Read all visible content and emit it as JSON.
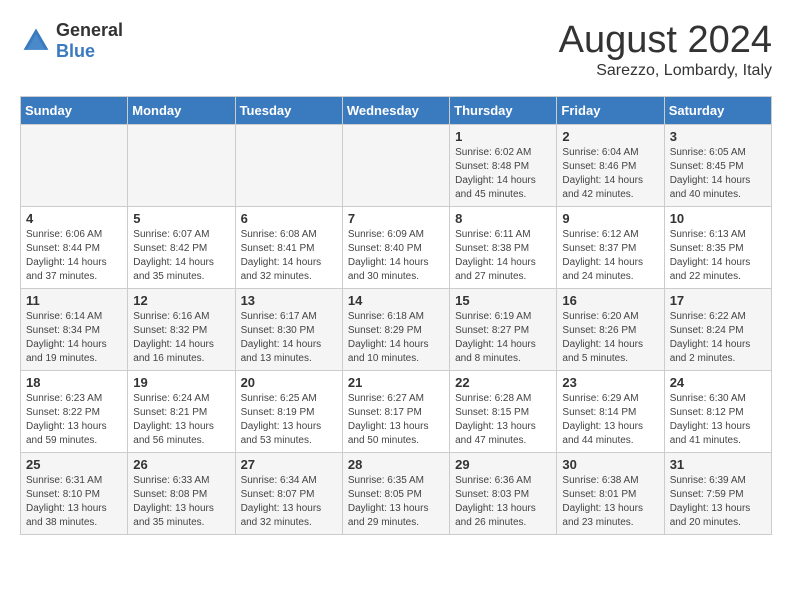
{
  "logo": {
    "general": "General",
    "blue": "Blue"
  },
  "calendar": {
    "title": "August 2024",
    "subtitle": "Sarezzo, Lombardy, Italy"
  },
  "headers": [
    "Sunday",
    "Monday",
    "Tuesday",
    "Wednesday",
    "Thursday",
    "Friday",
    "Saturday"
  ],
  "weeks": [
    [
      {
        "day": "",
        "info": ""
      },
      {
        "day": "",
        "info": ""
      },
      {
        "day": "",
        "info": ""
      },
      {
        "day": "",
        "info": ""
      },
      {
        "day": "1",
        "info": "Sunrise: 6:02 AM\nSunset: 8:48 PM\nDaylight: 14 hours\nand 45 minutes."
      },
      {
        "day": "2",
        "info": "Sunrise: 6:04 AM\nSunset: 8:46 PM\nDaylight: 14 hours\nand 42 minutes."
      },
      {
        "day": "3",
        "info": "Sunrise: 6:05 AM\nSunset: 8:45 PM\nDaylight: 14 hours\nand 40 minutes."
      }
    ],
    [
      {
        "day": "4",
        "info": "Sunrise: 6:06 AM\nSunset: 8:44 PM\nDaylight: 14 hours\nand 37 minutes."
      },
      {
        "day": "5",
        "info": "Sunrise: 6:07 AM\nSunset: 8:42 PM\nDaylight: 14 hours\nand 35 minutes."
      },
      {
        "day": "6",
        "info": "Sunrise: 6:08 AM\nSunset: 8:41 PM\nDaylight: 14 hours\nand 32 minutes."
      },
      {
        "day": "7",
        "info": "Sunrise: 6:09 AM\nSunset: 8:40 PM\nDaylight: 14 hours\nand 30 minutes."
      },
      {
        "day": "8",
        "info": "Sunrise: 6:11 AM\nSunset: 8:38 PM\nDaylight: 14 hours\nand 27 minutes."
      },
      {
        "day": "9",
        "info": "Sunrise: 6:12 AM\nSunset: 8:37 PM\nDaylight: 14 hours\nand 24 minutes."
      },
      {
        "day": "10",
        "info": "Sunrise: 6:13 AM\nSunset: 8:35 PM\nDaylight: 14 hours\nand 22 minutes."
      }
    ],
    [
      {
        "day": "11",
        "info": "Sunrise: 6:14 AM\nSunset: 8:34 PM\nDaylight: 14 hours\nand 19 minutes."
      },
      {
        "day": "12",
        "info": "Sunrise: 6:16 AM\nSunset: 8:32 PM\nDaylight: 14 hours\nand 16 minutes."
      },
      {
        "day": "13",
        "info": "Sunrise: 6:17 AM\nSunset: 8:30 PM\nDaylight: 14 hours\nand 13 minutes."
      },
      {
        "day": "14",
        "info": "Sunrise: 6:18 AM\nSunset: 8:29 PM\nDaylight: 14 hours\nand 10 minutes."
      },
      {
        "day": "15",
        "info": "Sunrise: 6:19 AM\nSunset: 8:27 PM\nDaylight: 14 hours\nand 8 minutes."
      },
      {
        "day": "16",
        "info": "Sunrise: 6:20 AM\nSunset: 8:26 PM\nDaylight: 14 hours\nand 5 minutes."
      },
      {
        "day": "17",
        "info": "Sunrise: 6:22 AM\nSunset: 8:24 PM\nDaylight: 14 hours\nand 2 minutes."
      }
    ],
    [
      {
        "day": "18",
        "info": "Sunrise: 6:23 AM\nSunset: 8:22 PM\nDaylight: 13 hours\nand 59 minutes."
      },
      {
        "day": "19",
        "info": "Sunrise: 6:24 AM\nSunset: 8:21 PM\nDaylight: 13 hours\nand 56 minutes."
      },
      {
        "day": "20",
        "info": "Sunrise: 6:25 AM\nSunset: 8:19 PM\nDaylight: 13 hours\nand 53 minutes."
      },
      {
        "day": "21",
        "info": "Sunrise: 6:27 AM\nSunset: 8:17 PM\nDaylight: 13 hours\nand 50 minutes."
      },
      {
        "day": "22",
        "info": "Sunrise: 6:28 AM\nSunset: 8:15 PM\nDaylight: 13 hours\nand 47 minutes."
      },
      {
        "day": "23",
        "info": "Sunrise: 6:29 AM\nSunset: 8:14 PM\nDaylight: 13 hours\nand 44 minutes."
      },
      {
        "day": "24",
        "info": "Sunrise: 6:30 AM\nSunset: 8:12 PM\nDaylight: 13 hours\nand 41 minutes."
      }
    ],
    [
      {
        "day": "25",
        "info": "Sunrise: 6:31 AM\nSunset: 8:10 PM\nDaylight: 13 hours\nand 38 minutes."
      },
      {
        "day": "26",
        "info": "Sunrise: 6:33 AM\nSunset: 8:08 PM\nDaylight: 13 hours\nand 35 minutes."
      },
      {
        "day": "27",
        "info": "Sunrise: 6:34 AM\nSunset: 8:07 PM\nDaylight: 13 hours\nand 32 minutes."
      },
      {
        "day": "28",
        "info": "Sunrise: 6:35 AM\nSunset: 8:05 PM\nDaylight: 13 hours\nand 29 minutes."
      },
      {
        "day": "29",
        "info": "Sunrise: 6:36 AM\nSunset: 8:03 PM\nDaylight: 13 hours\nand 26 minutes."
      },
      {
        "day": "30",
        "info": "Sunrise: 6:38 AM\nSunset: 8:01 PM\nDaylight: 13 hours\nand 23 minutes."
      },
      {
        "day": "31",
        "info": "Sunrise: 6:39 AM\nSunset: 7:59 PM\nDaylight: 13 hours\nand 20 minutes."
      }
    ]
  ]
}
